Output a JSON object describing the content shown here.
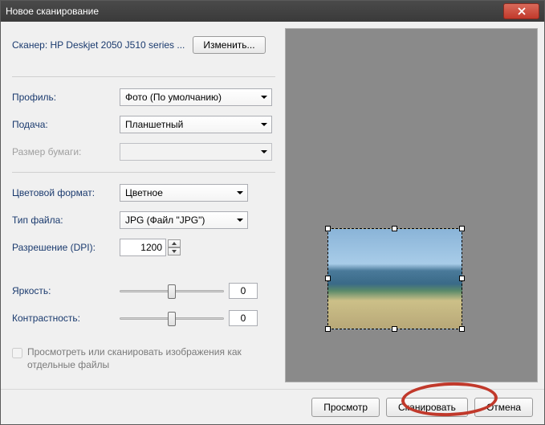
{
  "window": {
    "title": "Новое сканирование"
  },
  "scanner": {
    "label": "Сканер:",
    "name": "HP Deskjet 2050 J510 series ...",
    "change_btn": "Изменить..."
  },
  "profile": {
    "label": "Профиль:",
    "value": "Фото (По умолчанию)"
  },
  "source": {
    "label": "Подача:",
    "value": "Планшетный"
  },
  "paper_size": {
    "label": "Размер бумаги:",
    "value": ""
  },
  "color_format": {
    "label": "Цветовой формат:",
    "value": "Цветное"
  },
  "file_type": {
    "label": "Тип файла:",
    "value": "JPG (Файл \"JPG\")"
  },
  "resolution": {
    "label": "Разрешение (DPI):",
    "value": "1200"
  },
  "brightness": {
    "label": "Яркость:",
    "value": "0"
  },
  "contrast": {
    "label": "Контрастность:",
    "value": "0"
  },
  "separate_files": {
    "label": "Просмотреть или сканировать изображения как отдельные файлы"
  },
  "buttons": {
    "preview": "Просмотр",
    "scan": "Сканировать",
    "cancel": "Отмена"
  }
}
